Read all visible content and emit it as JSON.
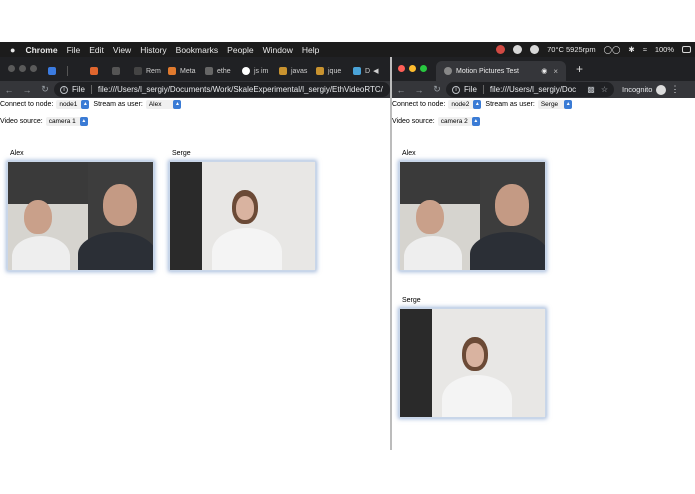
{
  "menubar": {
    "apple": "",
    "items": [
      "Chrome",
      "File",
      "Edit",
      "View",
      "History",
      "Bookmarks",
      "People",
      "Window",
      "Help"
    ],
    "status": "70°C 5925rpm",
    "battery": "100%"
  },
  "left": {
    "tabs": [
      "Rem",
      "Meta",
      "ethe",
      "js im",
      "javas",
      "jque",
      "D"
    ],
    "url_scheme": "File",
    "url": "file:///Users/l_sergiy/Documents/Work/SkaleExperimental/l_sergiy/EthVideoRTC/",
    "node_label": "Connect to node:",
    "node_value": "node1",
    "user_label": "Stream as user:",
    "user_value": "Alex",
    "source_label": "Video source:",
    "source_value": "camera 1",
    "videos": [
      {
        "label": "Alex"
      },
      {
        "label": "Serge"
      }
    ]
  },
  "right": {
    "tab_title": "Motion Pictures Test",
    "tab_close": "×",
    "new_tab": "+",
    "url_scheme": "File",
    "url": "file:///Users/l_sergiy/Doc",
    "incognito": "Incognito",
    "node_label": "Connect to node:",
    "node_value": "node2",
    "user_label": "Stream as user:",
    "user_value": "Serge",
    "source_label": "Video source:",
    "source_value": "camera 2",
    "videos": [
      {
        "label": "Alex"
      },
      {
        "label": "Serge"
      }
    ]
  }
}
